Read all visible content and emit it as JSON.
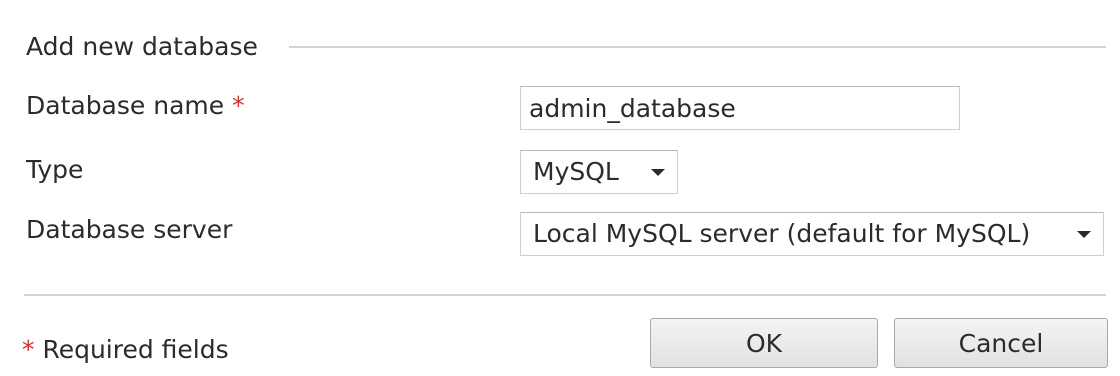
{
  "section": {
    "title": "Add new database"
  },
  "fields": {
    "database_name": {
      "label": "Database name",
      "required_marker": "*",
      "value": "admin_database"
    },
    "type": {
      "label": "Type",
      "selected": "MySQL"
    },
    "database_server": {
      "label": "Database server",
      "selected": "Local MySQL server (default for MySQL)"
    }
  },
  "footer": {
    "required_marker": "*",
    "required_note": "Required fields",
    "ok_label": "OK",
    "cancel_label": "Cancel"
  },
  "icons": {
    "dropdown": "chevron-down-icon"
  },
  "colors": {
    "required": "#d0302f",
    "text": "#2b2b2b",
    "border": "#cfcfcf"
  }
}
